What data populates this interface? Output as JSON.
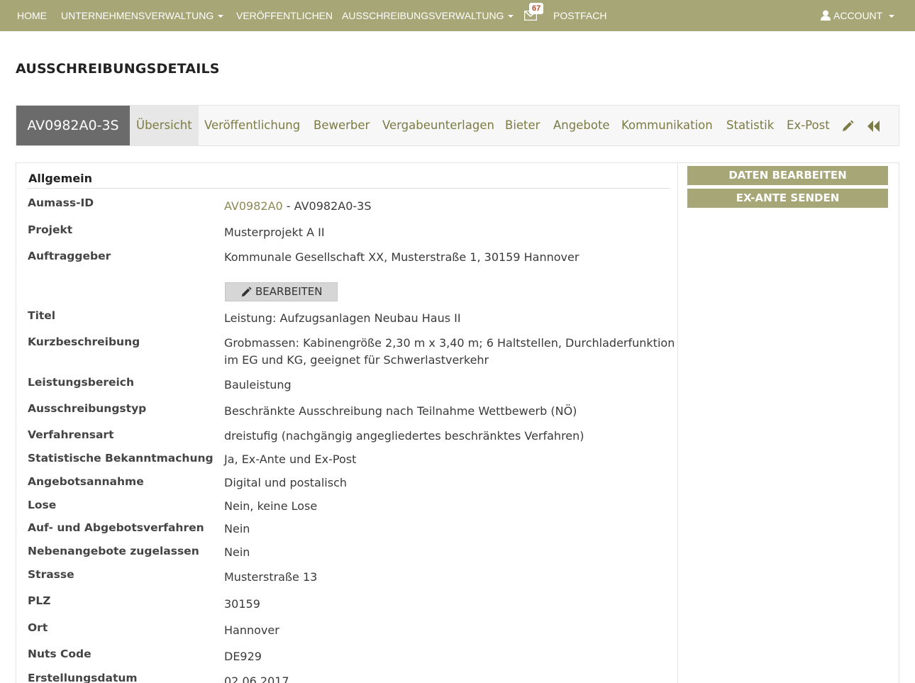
{
  "nav": {
    "home": "HOME",
    "company": "UNTERNEHMENSVERWALTUNG",
    "publish": "VERÖFFENTLICHEN",
    "tender_admin": "AUSSCHREIBUNGSVERWALTUNG",
    "mail_badge": "67",
    "inbox": "POSTFACH",
    "account": "ACCOUNT"
  },
  "page_title": "AUSSCHREIBUNGSDETAILS",
  "tabs": {
    "id": "AV0982A0-3S",
    "items": [
      "Übersicht",
      "Veröffentlichung",
      "Bewerber",
      "Vergabeunterlagen",
      "Bieter",
      "Angebote",
      "Kommunikation",
      "Statistik",
      "Ex-Post"
    ],
    "active": "Übersicht",
    "icons": [
      "pencil-icon",
      "double-chevron-left-icon"
    ]
  },
  "section_title": "Allgemein",
  "edit_button": "BEARBEITEN",
  "fields": {
    "aumass_id_label": "Aumass-ID",
    "aumass_id_link": "AV0982A0",
    "aumass_id_rest": " - AV0982A0-3S",
    "projekt_label": "Projekt",
    "projekt": "Musterprojekt A II",
    "auftraggeber_label": "Auftraggeber",
    "auftraggeber": "Kommunale Gesellschaft XX, Musterstraße 1, 30159 Hannover",
    "titel_label": "Titel",
    "titel": "Leistung: Aufzugsanlagen Neubau Haus II",
    "kurz_label": "Kurzbeschreibung",
    "kurz_line1": "Grobmassen: Kabinengröße 2,30 m x 3,40 m; 6 Haltstellen, Durchladerfunktion",
    "kurz_line2": "im EG und KG, geeignet für Schwerlastverkehr",
    "leistungsbereich_label": "Leistungsbereich",
    "leistungsbereich": "Bauleistung",
    "typ_label": "Ausschreibungstyp",
    "typ": "Beschränkte Ausschreibung nach Teilnahme Wettbewerb (NÖ)",
    "verfahren_label": "Verfahrensart",
    "verfahren": "dreistufig (nachgängig angegliedertes beschränktes Verfahren)",
    "stat_label": "Statistische Bekanntmachung",
    "stat": "Ja, Ex-Ante und Ex-Post",
    "annahme_label": "Angebotsannahme",
    "annahme": "Digital und postalisch",
    "lose_label": "Lose",
    "lose": "Nein, keine Lose",
    "aufab_label": "Auf- und Abgebotsverfahren",
    "aufab": "Nein",
    "neben_label": "Nebenangebote zugelassen",
    "neben": "Nein",
    "strasse_label": "Strasse",
    "strasse": "Musterstraße 13",
    "plz_label": "PLZ",
    "plz": "30159",
    "ort_label": "Ort",
    "ort": "Hannover",
    "nuts_label": "Nuts Code",
    "nuts": "DE929",
    "erstellung_label": "Erstellungsdatum",
    "erstellung": "02.06.2017"
  },
  "side": {
    "edit_data": "DATEN BEARBEITEN",
    "send_exante": "EX-ANTE SENDEN"
  },
  "colors": {
    "accent": "#a6a677",
    "tab_text": "#7b7b45",
    "id_tab_bg": "#6b6b6b"
  }
}
